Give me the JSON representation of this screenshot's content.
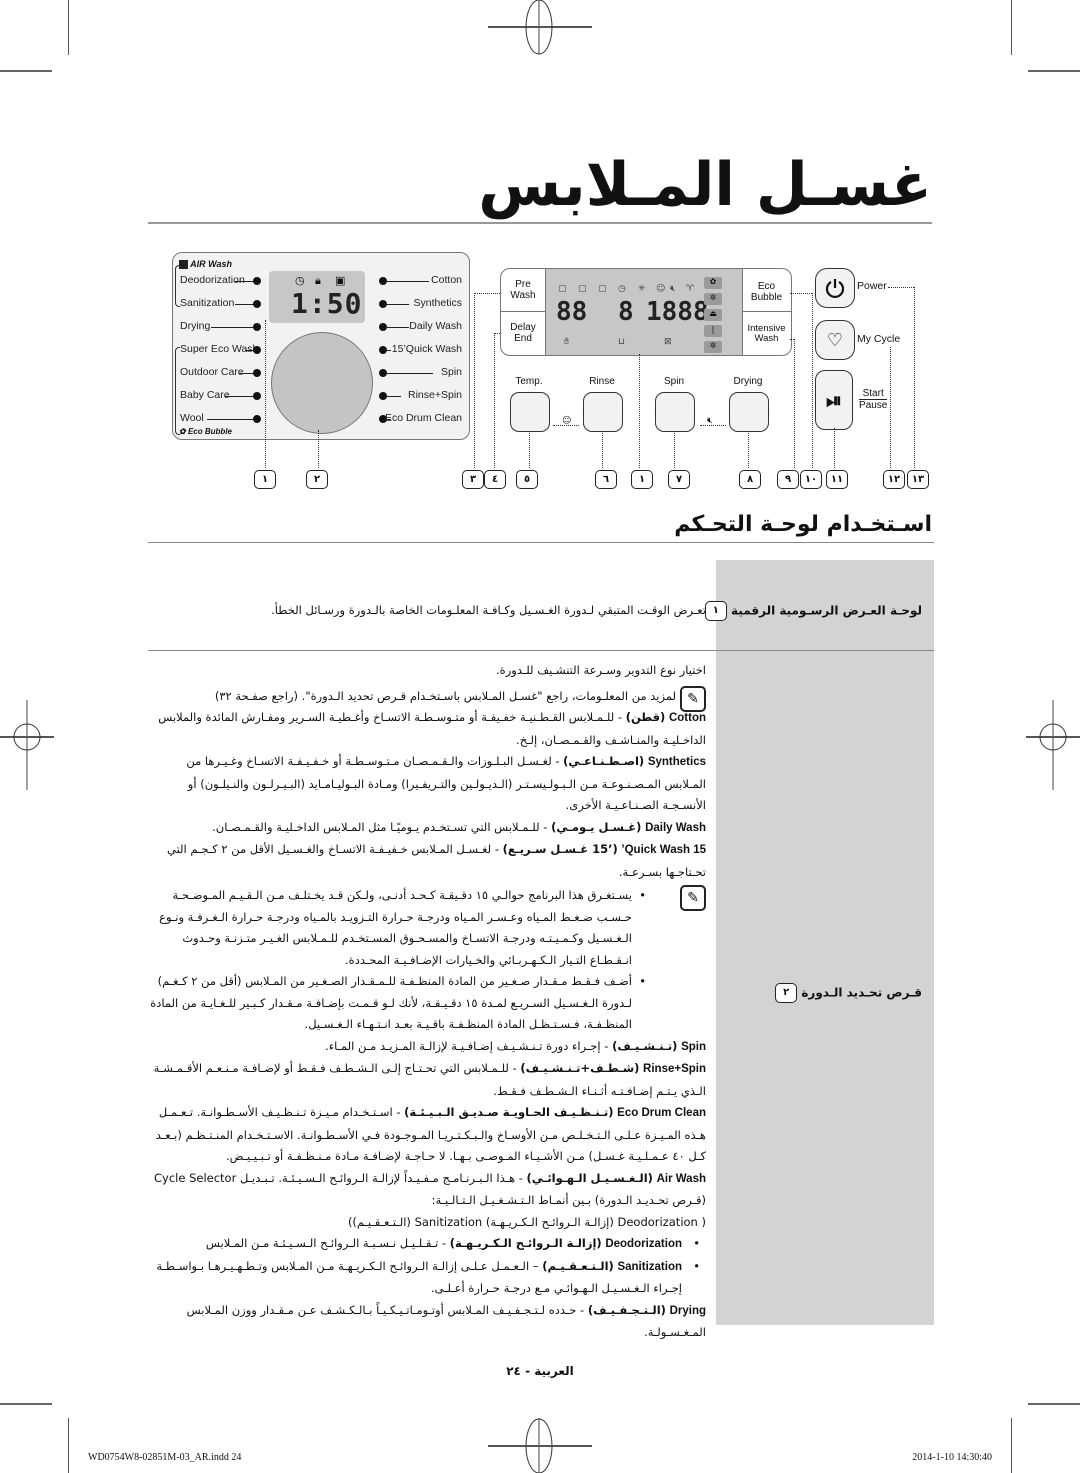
{
  "page": {
    "title": "غسـل المـلابس",
    "section_title": "اسـتخـدام لوحـة التحـكم",
    "footer_page": "العربية - ٢٤",
    "footer_file": "WD0754W8-02851M-03_AR.indd   24",
    "footer_date": "2014-1-10   14:30:40"
  },
  "dial_panel": {
    "air_wash_badge": "AIR Wash",
    "eco_bubble_badge": "Eco Bubble",
    "left_programs": [
      "Deodorization",
      "Sanitization",
      "Drying",
      "Super Eco Wash",
      "Outdoor Care",
      "Baby Care",
      "Wool"
    ],
    "right_programs": [
      "Cotton",
      "Synthetics",
      "Daily Wash",
      "15’Quick Wash",
      "Spin",
      "Rinse+Spin",
      "Eco Drum Clean"
    ],
    "display_time": "1:50",
    "display_icons": [
      "timer-icon",
      "lock-icon",
      "detergent-icon"
    ]
  },
  "control_panel": {
    "pre_wash": "Pre\nWash",
    "pre_wash_l1": "Pre",
    "pre_wash_l2": "Wash",
    "delay_end_l1": "Delay",
    "delay_end_l2": "End",
    "eco_bubble_l1": "Eco",
    "eco_bubble_l2": "Bubble",
    "intensive_l1": "Intensive",
    "intensive_l2": "Wash",
    "lcd_digits_a": "88",
    "lcd_digits_b": "8",
    "lcd_digits_c": "1888",
    "buttons": [
      "Temp.",
      "Rinse",
      "Spin",
      "Drying"
    ]
  },
  "side_buttons": {
    "power": "Power",
    "my_cycle": "My Cycle",
    "start": "Start",
    "pause": "Pause"
  },
  "callouts": [
    "١",
    "٢",
    "٣",
    "٤",
    "٥",
    "٦",
    "١",
    "٧",
    "٨",
    "٩",
    "١٠",
    "١١",
    "١٢",
    "١٣"
  ],
  "table": {
    "rows": [
      {
        "num": "١",
        "label": "لوحـة العـرض الرسـومية الرقمية",
        "text": "تعـرض الوقـت المتبقي لـدورة الغـسـيل وكـافـة المعلـومات الخاصة بالـدورة ورسـائل الخطأ."
      },
      {
        "num": "٢",
        "label": "قـرص تحـديد الـدورة",
        "intro": "اختيار نوع التدوير وسـرعة التنشـيف للـدورة.",
        "note1": "لمزيد من المعلـومات، راجع \"غسـل المـلابس باسـتخـدام قـرص تحديد الـدورة\". (راجع صفـحة ٣٢)",
        "items": [
          {
            "en": "Cotton",
            "ar_name": "(قطن)",
            "text": "- للـمـلابس القـطـنيـة خفـيفـة أو متـوسـطـة الاتسـاخ وأغـطيـة السـرير ومفـارش المائدة والملابس الداخـليـة والمنـاشـف والقـمـصـان، إلـخ."
          },
          {
            "en": "Synthetics",
            "ar_name": "(اصـطـنـاعـي)",
            "text": "- لغـسـل البـلـوزات والـقـمـصـان مـتـوسـطـة أو خـفـيـفـة الاتسـاخ وغـيـرها من المـلابس المـصـنـوعـة مـن الـبـولـيسـتـر (الـديـولـين والتـريفـيرا) ومـادة البـوليـامـايد (البـيـرلـون والنـيلـون) أو الأنسـجـة الصـنـاعـيـة الأخرى."
          },
          {
            "en": "Daily Wash",
            "ar_name": "(غـسـل يـومـي)",
            "text": "- للـمـلابس التي تسـتخـدم يـوميًـا مثل المـلابس الداخـليـة والقـمـصـان."
          },
          {
            "en": "Quick Wash 15’",
            "ar_name": "(’15 غـسـل سـريـع)",
            "text": "- لغـسـل المـلابس خـفيـفـة الاتسـاخ والغـسـيل الأقل من ٢ كـجـم التي تحـتاجـها بسـرعـة."
          }
        ],
        "note2_bullets": [
          "يسـتغـرق هذا البرنامج حوالـي ١٥ دقـيقـة كـحـد أدنـى، ولـكن قـد يخـتلـف مـن الـقـيـم المـوضـحـة حـسـب ضـغـط المـياه وعـسـر المـياه ودرجـة حـرارة التـزويـد بالمـياه ودرجـة حـرارة الـغـرفـة ونـوع الـغـسـيل وكـمـيـتـه ودرجـة الاتسـاخ والمسـحـوق المسـتخـدم للـمـلابس الغـيـر متـزنـة وحـدوث انـقـطـاع التـيار الـكـهـربـائي والخـيارات الإضـافـيـة المحـددة.",
          "أضـف فـقـط مـقـدار صـغـير من المادة المنظـفـة للـمـقـدار الصـغـير من المـلابس (أقل من ٢ كـغـم) لـدورة الـغـسـيل السـريـع لمـدة ١٥ دقـيـقـة، لأنك لـو قـمـت بإضـافـة مـقـدار كـبـير للـغـايـة من المادة المنظـفـة، فـسـتـظـل المادة المنظـفـة باقـيـة بعـد انـتـهـاء الـغـسـيل."
        ],
        "items2": [
          {
            "en": "Spin",
            "ar_name": "(تـنـشـيـف)",
            "text": "- إجـراء دورة تـنـشـيـف إضـافـيـة لإزالـة المـزيـد مـن المـاء."
          },
          {
            "en": "Rinse+Spin",
            "ar_name": "(شـطـف+تـنـشـيـف)",
            "text": "- للـمـلابس التي تحـتـاج إلـى الـشـطـف فـقـط أو لإضـافـة مـنـعـم الأقـمـشـة الـذي يـتـم إضـافـتـه أثـنـاء الـشـطـف فـقـط."
          },
          {
            "en": "Eco Drum Clean",
            "ar_name": "(تـنـظـيـف الحـاويـة صـديـق الـبـيـئـة)",
            "text": "- اسـتـخـدام مـيـزة تـنـظـيـف الأسـطـوانـة. تـعـمـل هـذه المـيـزة عـلـى الـتـخـلـص مـن الأوسـاخ والـبـكـتـريـا المـوجـودة فـي الأسـطـوانـة. الاسـتـخـدام المنـتـظـم (بـعـد كـل ٤٠ عـمـلـيـة غـسـل) مـن الأشـيـاء المـوصـى بـهـا. لا حـاجـة لإضـافـة مـادة مـنـظـفـة أو تـبـيـيـض."
          },
          {
            "en": "Air Wash",
            "ar_name": "(الـغـسـيـل الـهـوائـي)",
            "text": "- هـذا الـبـرنـامـج مـفـيـداً لإزالـة الـروائـح الـسـيـئـة. تـبـديـل Cycle Selector (قـرص تحـديـد الـدورة) بـين أنمـاط الـتـشـغـيـل الـتـالـيـة:"
          }
        ],
        "air_modes_line": "( Deodorization (إزالـة الـروائـح الـكـريـهـة) Sanitization (الـتـعـقـيـم))",
        "air_bullets": [
          {
            "en": "Deodorization",
            "ar_name": "(إزالـة الـروائـح الـكـريـهـة)",
            "text": "- تـقـلـيـل نـسـبـة الـروائـح الـسـيـئـة مـن المـلابس"
          },
          {
            "en": "Sanitization",
            "ar_name": "(الـتـعـقـيـم)",
            "text": "– الـعـمـل عـلـى إزالـة الـروائـح الـكـريـهـة مـن المـلابس وتـطـهـيـرهـا بـواسـطـة إجـراء الـغـسـيـل الـهـوائـي مـع درجـة حـرارة أعـلـى."
          }
        ],
        "drying": {
          "en": "Drying",
          "ar_name": "(الـتـجـفـيـف)",
          "text": "- حـدده لـتـجـفـيـف المـلابس أوتـومـاتـيـكـيـاً بـالـكـشـف عـن مـقـدار ووزن المـلابس المـغـسـولـة."
        }
      }
    ]
  }
}
